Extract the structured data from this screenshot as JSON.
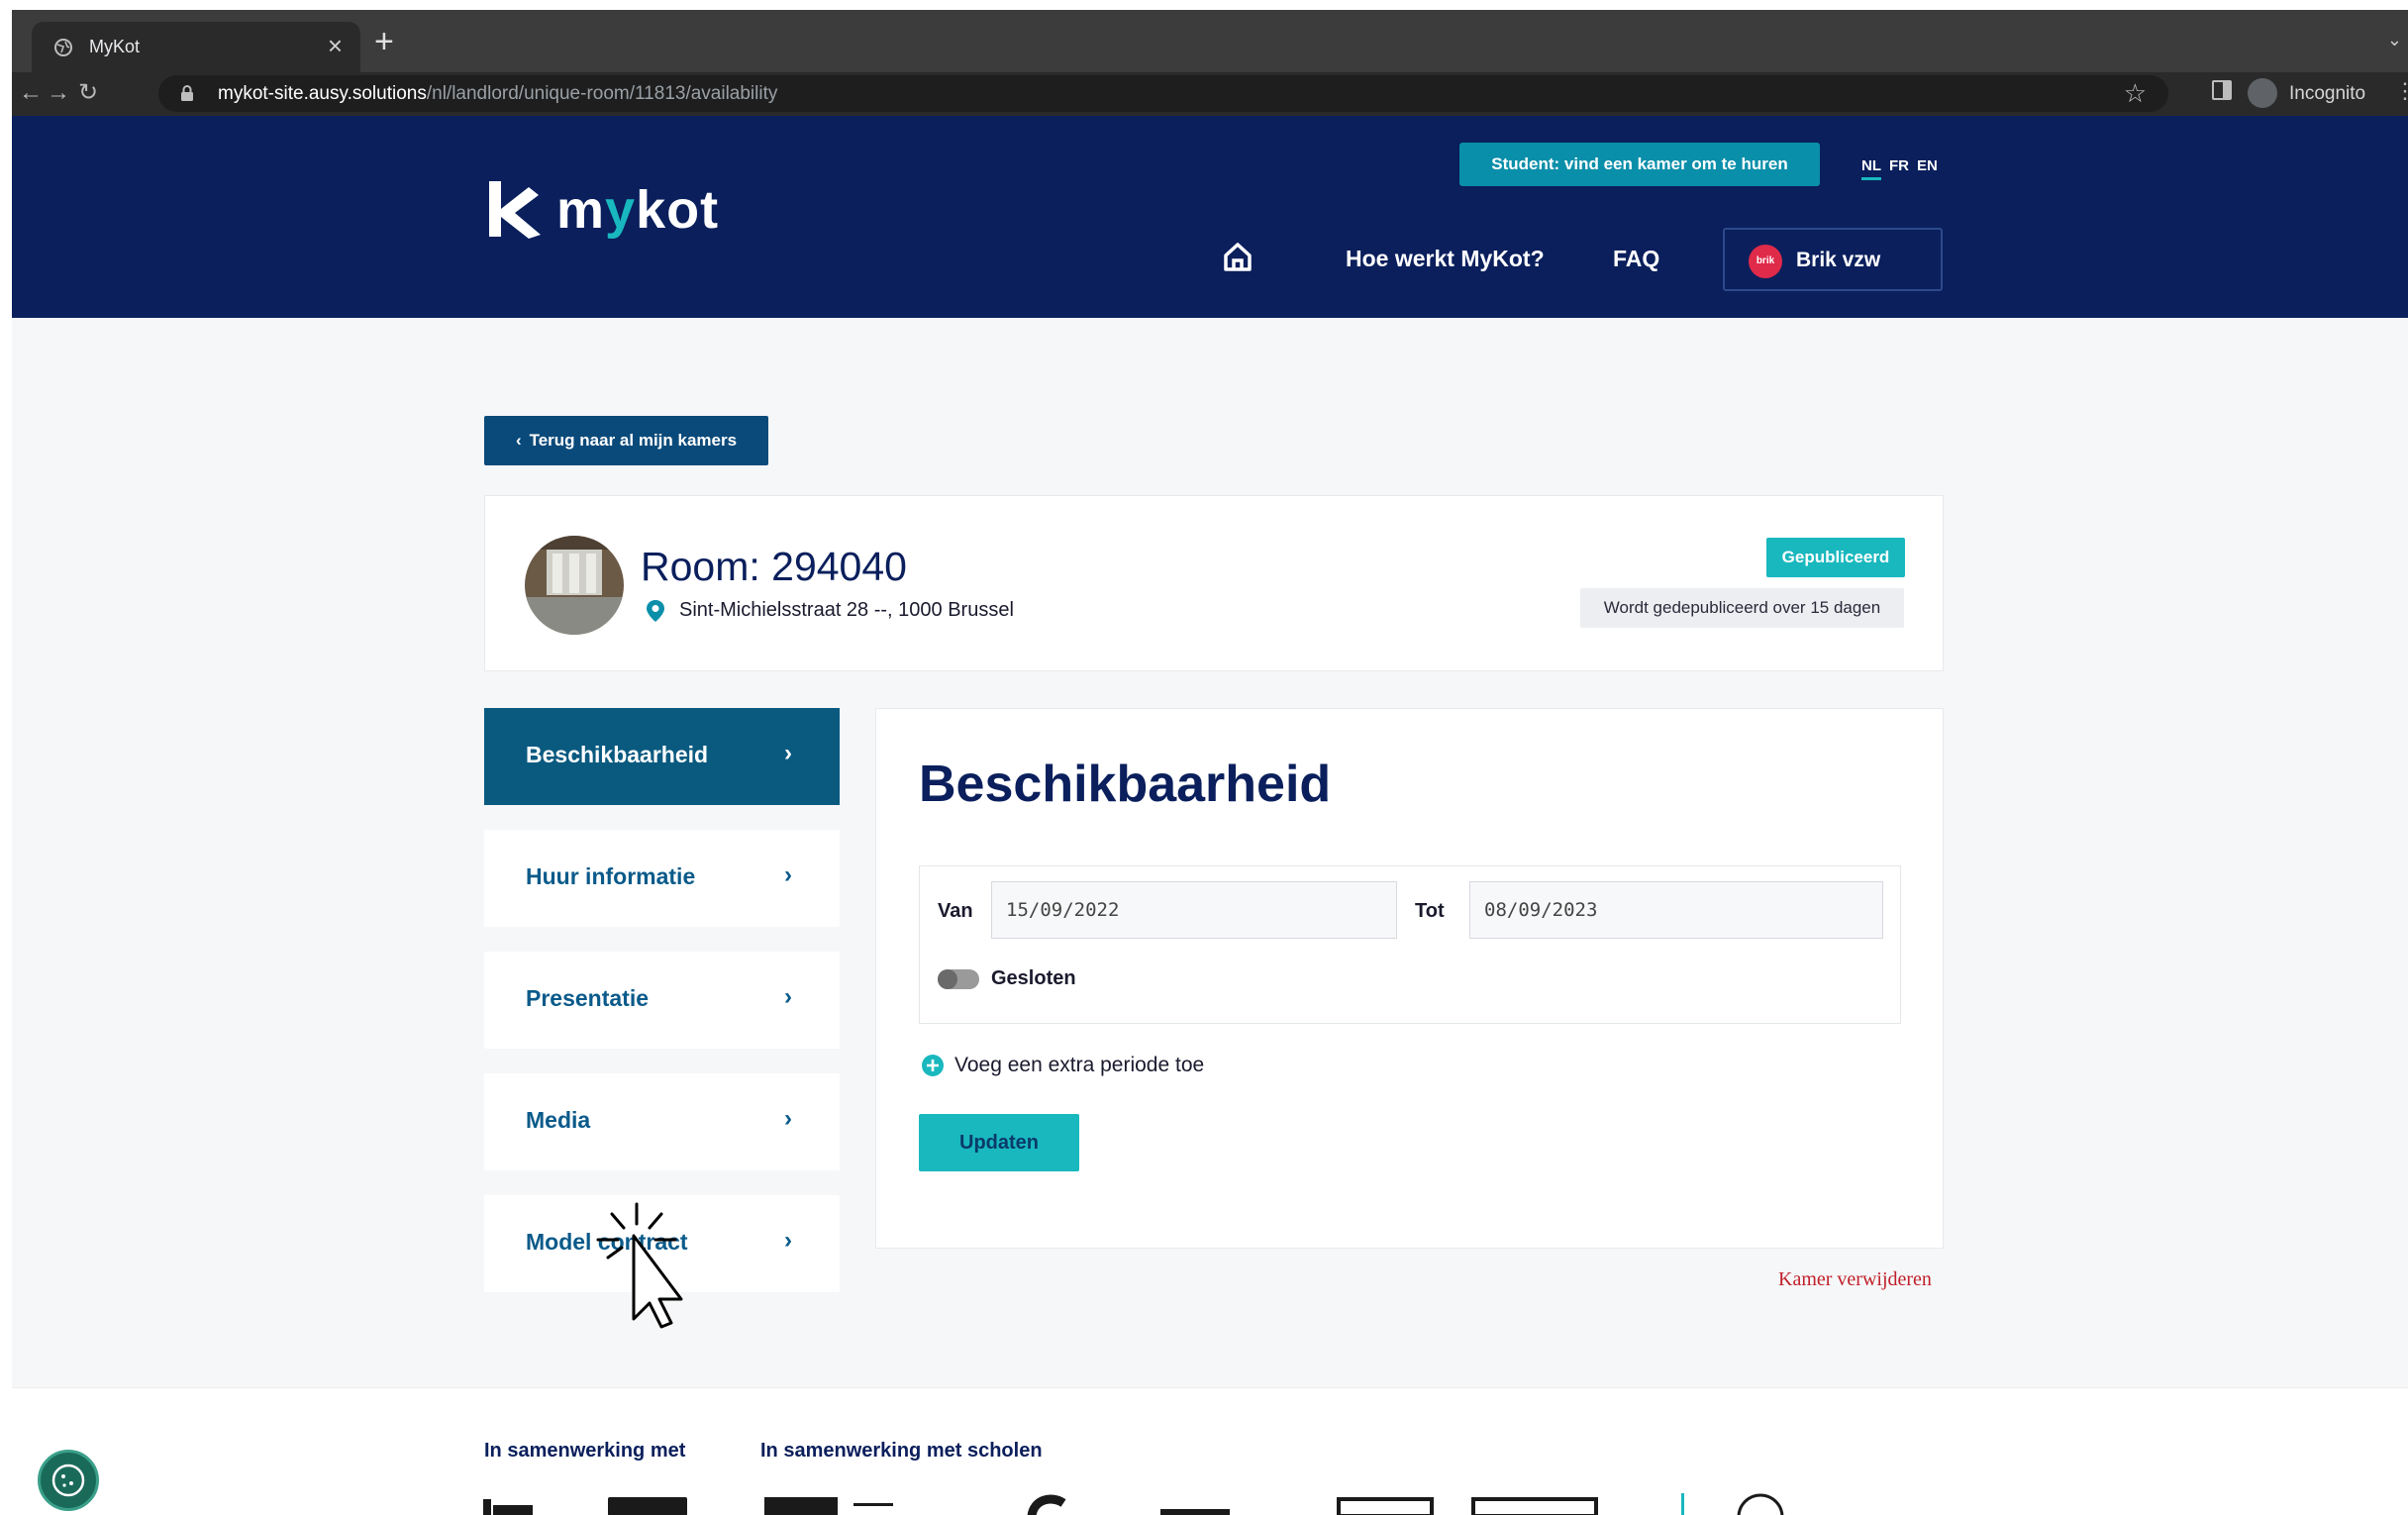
{
  "browser": {
    "tab_title": "MyKot",
    "tab_close": "×",
    "new_tab": "+",
    "url_host": "mykot-site.ausy.solutions",
    "url_path": "/nl/landlord/unique-room/11813/availability",
    "incognito_label": "Incognito",
    "back_glyph": "←",
    "forward_glyph": "→",
    "reload_glyph": "↻",
    "star_glyph": "☆",
    "tab_menu_glyph": "⌄",
    "kebab_glyph": "⋮"
  },
  "header": {
    "logo_text_pre": "m",
    "logo_text_y": "y",
    "logo_text_post": "kot",
    "student_cta": "Student: vind een kamer om te huren",
    "languages": [
      "NL",
      "FR",
      "EN"
    ],
    "nav": {
      "how": "Hoe werkt MyKot?",
      "faq": "FAQ"
    },
    "account": {
      "avatar_text": "brik",
      "name": "Brik vzw"
    }
  },
  "back_button": {
    "chevron": "‹",
    "label": "Terug naar al mijn kamers"
  },
  "room": {
    "title": "Room: 294040",
    "address": "Sint-Michielsstraat 28 --, 1000 Brussel",
    "status_badge": "Gepubliceerd",
    "publish_note": "Wordt gedepubliceerd over 15 dagen"
  },
  "side_menu": [
    {
      "label": "Beschikbaarheid",
      "chevron": "›"
    },
    {
      "label": "Huur informatie",
      "chevron": "›"
    },
    {
      "label": "Presentatie",
      "chevron": "›"
    },
    {
      "label": "Media",
      "chevron": "›"
    },
    {
      "label": "Model contract",
      "chevron": "›"
    }
  ],
  "availability": {
    "title": "Beschikbaarheid",
    "from_label": "Van",
    "from_value": "15/09/2022",
    "to_label": "Tot",
    "to_value": "08/09/2023",
    "closed_label": "Gesloten",
    "closed_on": false,
    "add_period": "Voeg een extra periode toe",
    "update_button": "Updaten",
    "delete_link": "Kamer verwijderen"
  },
  "footer": {
    "partners_heading": "In samenwerking met",
    "schools_heading": "In samenwerking met scholen"
  },
  "colors": {
    "navy": "#0a1f5c",
    "teal": "#19b8be",
    "active_menu": "#0a5a80",
    "danger": "#c0202a"
  },
  "icons": [
    "globe-icon",
    "lock-icon",
    "star-icon",
    "home-icon",
    "pin-icon",
    "plus-circle-icon",
    "cookie-icon",
    "cursor-icon"
  ]
}
